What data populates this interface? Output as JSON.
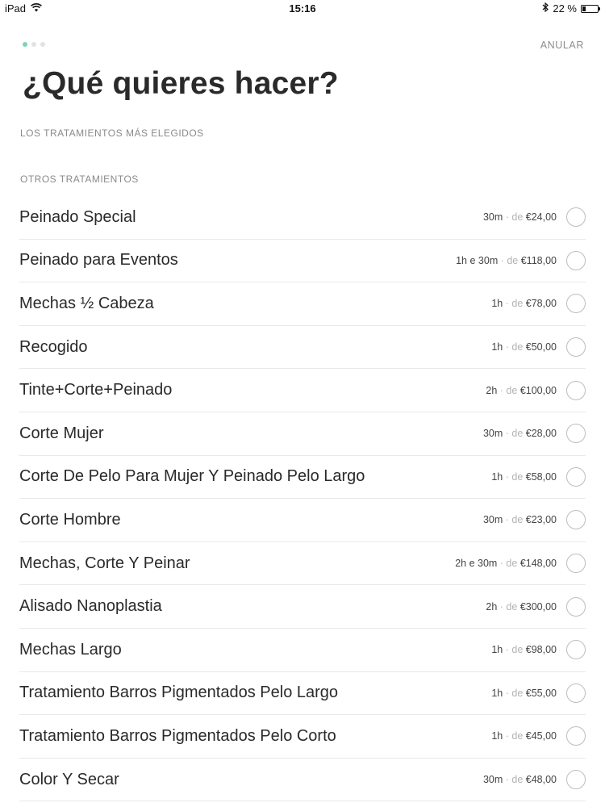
{
  "status_bar": {
    "device": "iPad",
    "time": "15:16",
    "battery": "22 %",
    "battery_level": 0.22
  },
  "header": {
    "cancel_label": "ANULAR",
    "title": "¿Qué quieres hacer?"
  },
  "sections": {
    "popular_label": "LOS TRATAMIENTOS MÁS ELEGIDOS",
    "others_label": "OTROS TRATAMIENTOS"
  },
  "meta_separator": " · de ",
  "treatments": [
    {
      "name": "Peinado Special",
      "duration": "30m",
      "price": "€24,00"
    },
    {
      "name": "Peinado para Eventos",
      "duration": "1h e 30m",
      "price": "€118,00"
    },
    {
      "name": "Mechas ½ Cabeza",
      "duration": "1h",
      "price": "€78,00"
    },
    {
      "name": "Recogido",
      "duration": "1h",
      "price": "€50,00"
    },
    {
      "name": "Tinte+Corte+Peinado",
      "duration": "2h",
      "price": "€100,00"
    },
    {
      "name": "Corte Mujer",
      "duration": "30m",
      "price": "€28,00"
    },
    {
      "name": "Corte De Pelo Para Mujer Y Peinado Pelo Largo",
      "duration": "1h",
      "price": "€58,00"
    },
    {
      "name": "Corte Hombre",
      "duration": "30m",
      "price": "€23,00"
    },
    {
      "name": "Mechas, Corte Y Peinar",
      "duration": "2h e 30m",
      "price": "€148,00"
    },
    {
      "name": "Alisado Nanoplastia",
      "duration": "2h",
      "price": "€300,00"
    },
    {
      "name": "Mechas Largo",
      "duration": "1h",
      "price": "€98,00"
    },
    {
      "name": "Tratamiento Barros Pigmentados Pelo Largo",
      "duration": "1h",
      "price": "€55,00"
    },
    {
      "name": "Tratamiento Barros Pigmentados Pelo Corto",
      "duration": "1h",
      "price": "€45,00"
    },
    {
      "name": "Color Y Secar",
      "duration": "30m",
      "price": "€48,00"
    }
  ]
}
